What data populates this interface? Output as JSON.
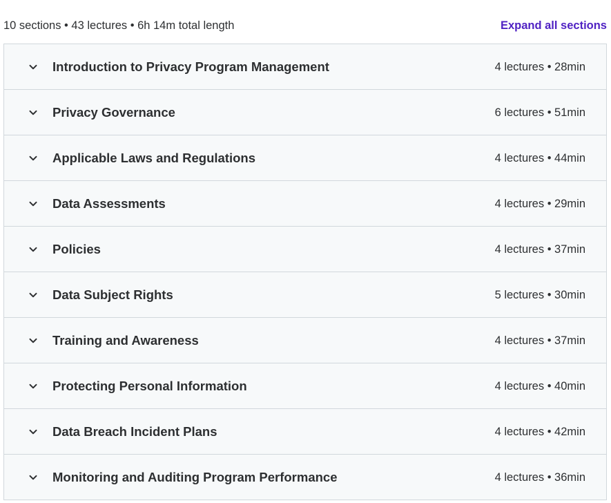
{
  "summary": {
    "text": "10 sections • 43 lectures • 6h 14m total length",
    "expand_label": "Expand all sections"
  },
  "colors": {
    "accent": "#5022c3",
    "section_bg": "#f7f9fa",
    "border": "#d1d7dc",
    "text": "#2d2f31"
  },
  "icons": {
    "section_toggle": "chevron-down-icon"
  },
  "sections": [
    {
      "title": "Introduction to Privacy Program Management",
      "meta": "4 lectures • 28min"
    },
    {
      "title": "Privacy Governance",
      "meta": "6 lectures • 51min"
    },
    {
      "title": "Applicable Laws and Regulations",
      "meta": "4 lectures • 44min"
    },
    {
      "title": "Data Assessments",
      "meta": "4 lectures • 29min"
    },
    {
      "title": "Policies",
      "meta": "4 lectures • 37min"
    },
    {
      "title": "Data Subject Rights",
      "meta": "5 lectures • 30min"
    },
    {
      "title": "Training and Awareness",
      "meta": "4 lectures • 37min"
    },
    {
      "title": "Protecting Personal Information",
      "meta": "4 lectures • 40min"
    },
    {
      "title": "Data Breach Incident Plans",
      "meta": "4 lectures • 42min"
    },
    {
      "title": "Monitoring and Auditing Program Performance",
      "meta": "4 lectures • 36min"
    }
  ]
}
